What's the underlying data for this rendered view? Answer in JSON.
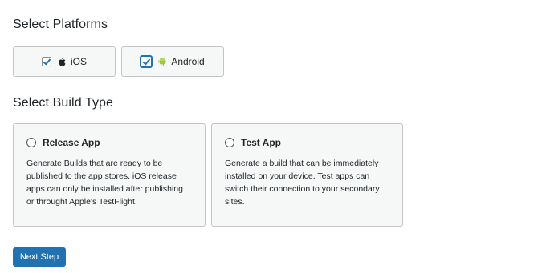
{
  "headings": {
    "platforms": "Select Platforms",
    "build_type": "Select Build Type"
  },
  "platforms": [
    {
      "label": "iOS",
      "checked": true,
      "icon": "apple-icon"
    },
    {
      "label": "Android",
      "checked": true,
      "icon": "android-icon",
      "icon_color": "#a4c639"
    }
  ],
  "build_types": [
    {
      "title": "Release App",
      "selected": false,
      "description": "Generate Builds that are ready to be published to the app stores. iOS release apps can only be installed after publishing or throught Apple's TestFlight."
    },
    {
      "title": "Test App",
      "selected": false,
      "description": "Generate a build that can be immediately installed on your device. Test apps can switch their connection to your secondary sites."
    }
  ],
  "actions": {
    "next_label": "Next Step"
  },
  "colors": {
    "accent": "#2271b1",
    "card_bg": "#f6f7f7",
    "card_border": "#c3c4c7",
    "android": "#a4c639"
  }
}
